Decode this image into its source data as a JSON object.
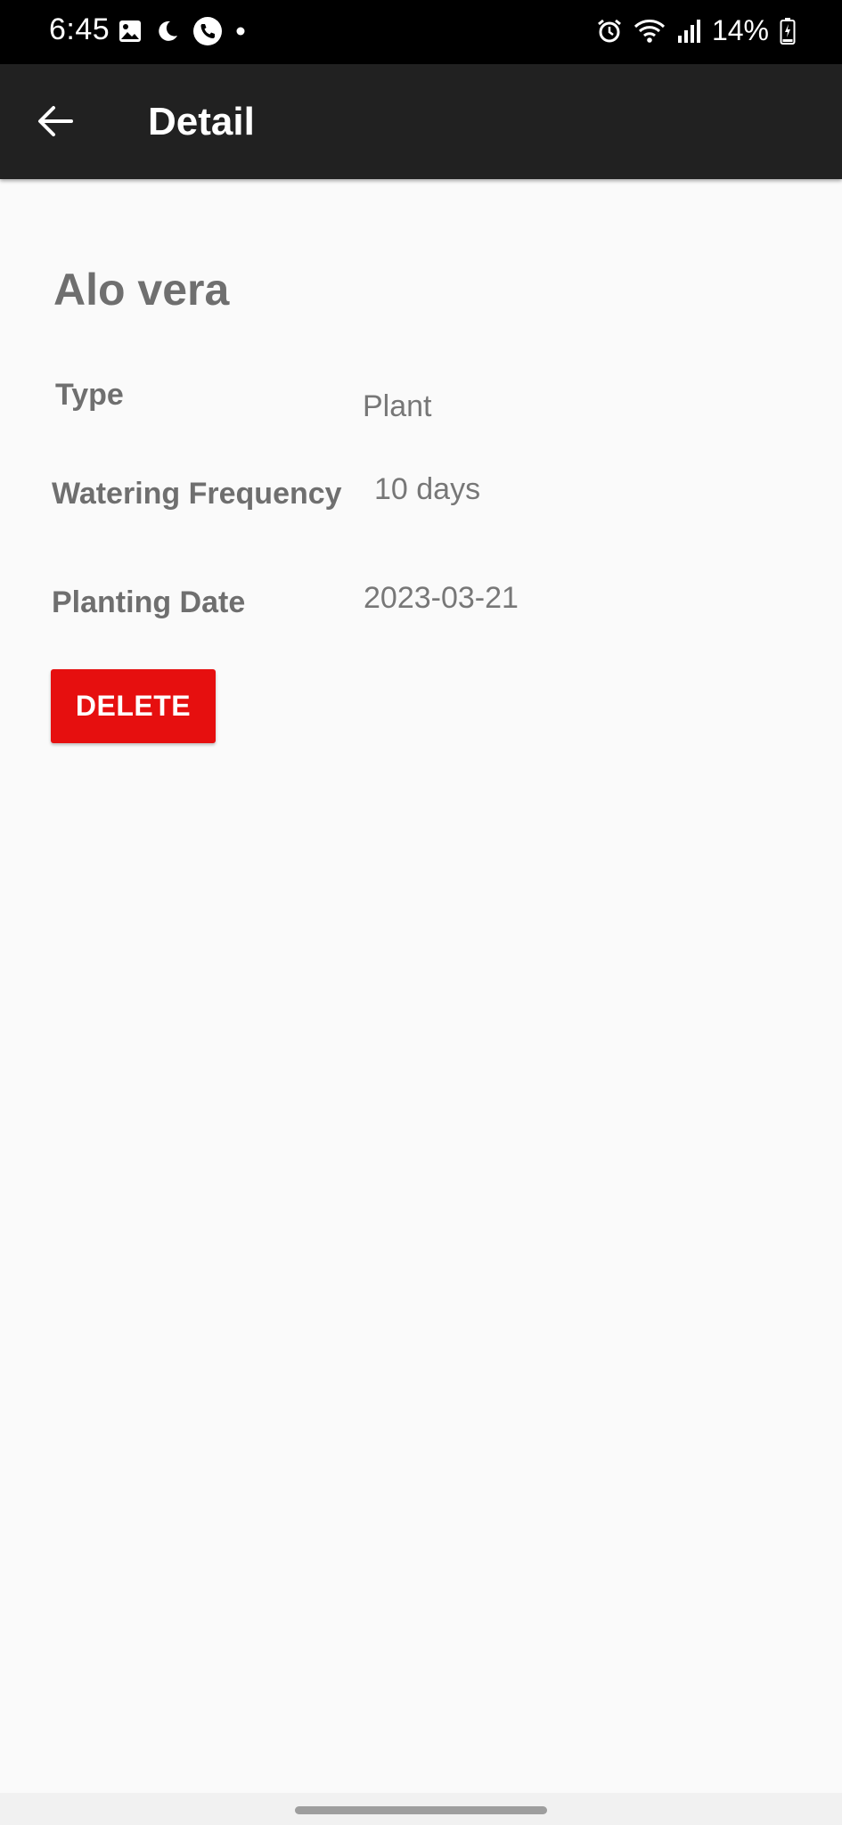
{
  "status_bar": {
    "time": "6:45",
    "battery": "14%",
    "left_icons": [
      "gallery-icon",
      "moon-icon",
      "phone-call-icon",
      "dot-icon"
    ],
    "right_icons": [
      "alarm-icon",
      "wifi-icon",
      "signal-icon",
      "battery-charging-icon"
    ]
  },
  "app_bar": {
    "title": "Detail",
    "back_icon": "arrow-left-icon",
    "background": "#212121"
  },
  "plant": {
    "name": "Alo vera",
    "fields": {
      "type": {
        "label": "Type",
        "value": "Plant"
      },
      "watering": {
        "label": "Watering Frequency",
        "value": "10 days"
      },
      "planting": {
        "label": "Planting Date",
        "value": "2023-03-21"
      }
    }
  },
  "actions": {
    "delete_label": "DELETE",
    "delete_color": "#e60f0f"
  }
}
